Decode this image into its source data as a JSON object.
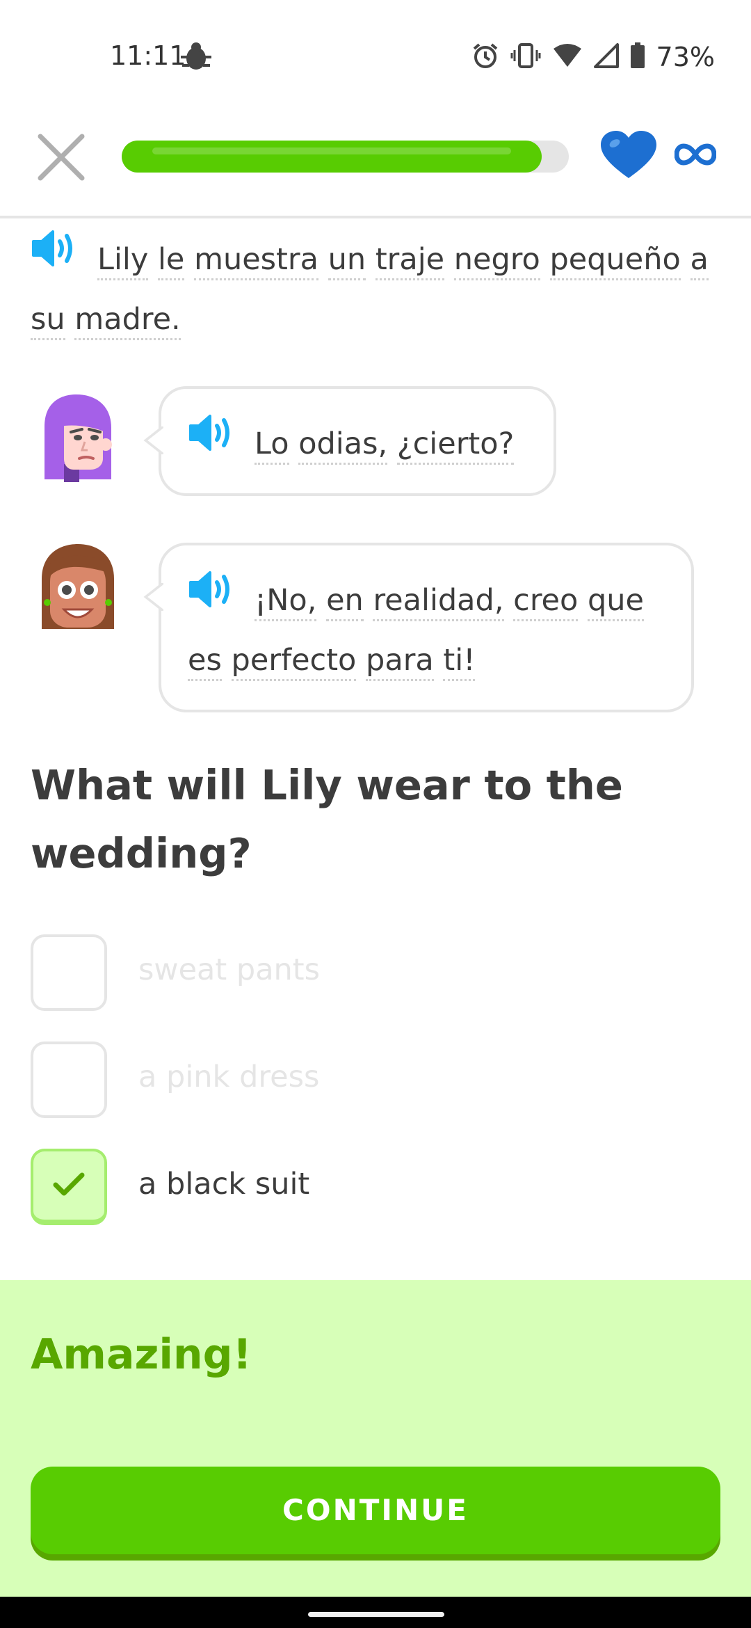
{
  "status_bar": {
    "time": "11:11",
    "battery": "73%",
    "icons": [
      "bug-icon",
      "alarm-icon",
      "vibrate-icon",
      "wifi-icon",
      "signal-icon",
      "battery-icon"
    ]
  },
  "header": {
    "progress": 0.94,
    "lives": "infinite",
    "icons": [
      "close-icon",
      "heart-icon",
      "infinity-icon"
    ],
    "colors": {
      "progress": "#58cc02",
      "heart": "#1d6fd1"
    }
  },
  "story": {
    "narration_words": [
      "Lily",
      "le",
      "muestra",
      "un",
      "traje",
      "negro",
      "pequeño",
      "a",
      "su",
      "madre."
    ],
    "dialog": [
      {
        "speaker": "Lily",
        "words": [
          "Lo",
          "odias,",
          "¿cierto?"
        ]
      },
      {
        "speaker": "mother",
        "words": [
          "¡No,",
          "en",
          "realidad,",
          "creo",
          "que",
          "es",
          "perfecto",
          "para",
          "ti!"
        ]
      }
    ]
  },
  "question": {
    "text": "What will Lily wear to the wedding?",
    "options": [
      {
        "label": "sweat pants",
        "selected": false
      },
      {
        "label": "a pink dress",
        "selected": false
      },
      {
        "label": "a black suit",
        "selected": true
      }
    ]
  },
  "feedback": {
    "title": "Amazing!",
    "button": "CONTINUE",
    "colors": {
      "panel": "#d7ffb8",
      "title": "#58a700",
      "button": "#58cc02"
    }
  }
}
